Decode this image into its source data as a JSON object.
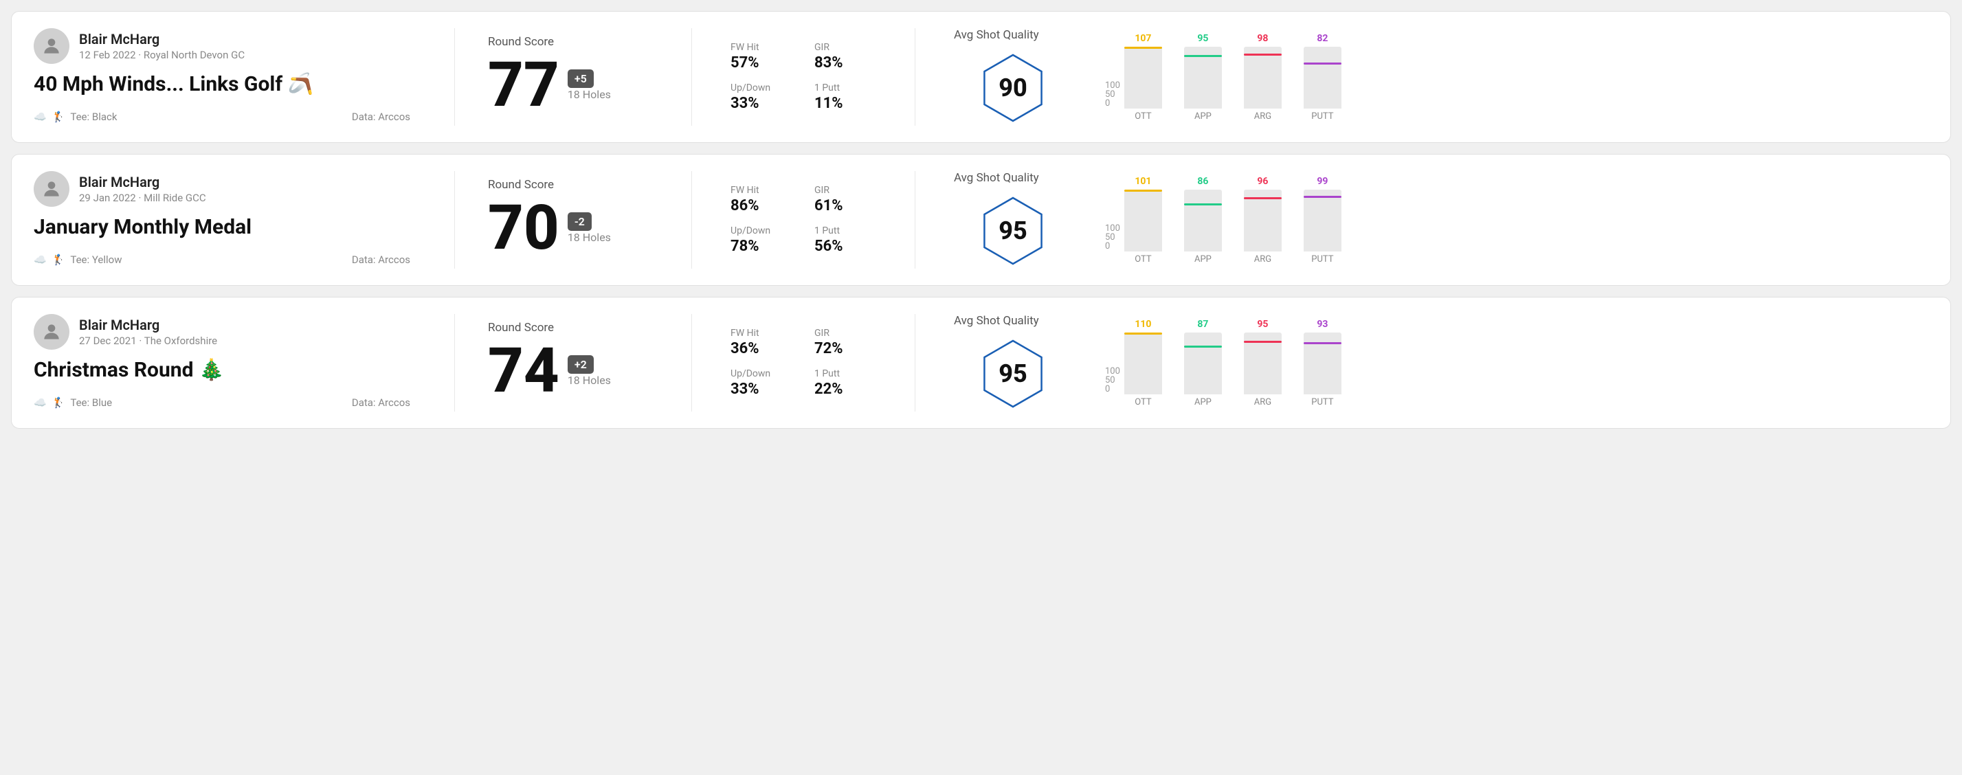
{
  "rounds": [
    {
      "id": "round-1",
      "user_name": "Blair McHarg",
      "date": "12 Feb 2022 · Royal North Devon GC",
      "title": "40 Mph Winds... Links Golf 🪃",
      "tee": "Black",
      "data_source": "Data: Arccos",
      "round_score_label": "Round Score",
      "score": "77",
      "score_diff": "+5",
      "holes": "18 Holes",
      "fw_hit_label": "FW Hit",
      "fw_hit_value": "57%",
      "gir_label": "GIR",
      "gir_value": "83%",
      "updown_label": "Up/Down",
      "updown_value": "33%",
      "oneputt_label": "1 Putt",
      "oneputt_value": "11%",
      "avg_shot_label": "Avg Shot Quality",
      "quality_score": "90",
      "chart_bars": [
        {
          "label": "OTT",
          "value": 107,
          "color": "#f0b800",
          "max": 100
        },
        {
          "label": "APP",
          "value": 95,
          "color": "#22cc88",
          "max": 100
        },
        {
          "label": "ARG",
          "value": 98,
          "color": "#ee3355",
          "max": 100
        },
        {
          "label": "PUTT",
          "value": 82,
          "color": "#aa44cc",
          "max": 100
        }
      ]
    },
    {
      "id": "round-2",
      "user_name": "Blair McHarg",
      "date": "29 Jan 2022 · Mill Ride GCC",
      "title": "January Monthly Medal",
      "tee": "Yellow",
      "data_source": "Data: Arccos",
      "round_score_label": "Round Score",
      "score": "70",
      "score_diff": "-2",
      "holes": "18 Holes",
      "fw_hit_label": "FW Hit",
      "fw_hit_value": "86%",
      "gir_label": "GIR",
      "gir_value": "61%",
      "updown_label": "Up/Down",
      "updown_value": "78%",
      "oneputt_label": "1 Putt",
      "oneputt_value": "56%",
      "avg_shot_label": "Avg Shot Quality",
      "quality_score": "95",
      "chart_bars": [
        {
          "label": "OTT",
          "value": 101,
          "color": "#f0b800",
          "max": 100
        },
        {
          "label": "APP",
          "value": 86,
          "color": "#22cc88",
          "max": 100
        },
        {
          "label": "ARG",
          "value": 96,
          "color": "#ee3355",
          "max": 100
        },
        {
          "label": "PUTT",
          "value": 99,
          "color": "#aa44cc",
          "max": 100
        }
      ]
    },
    {
      "id": "round-3",
      "user_name": "Blair McHarg",
      "date": "27 Dec 2021 · The Oxfordshire",
      "title": "Christmas Round 🎄",
      "tee": "Blue",
      "data_source": "Data: Arccos",
      "round_score_label": "Round Score",
      "score": "74",
      "score_diff": "+2",
      "holes": "18 Holes",
      "fw_hit_label": "FW Hit",
      "fw_hit_value": "36%",
      "gir_label": "GIR",
      "gir_value": "72%",
      "updown_label": "Up/Down",
      "updown_value": "33%",
      "oneputt_label": "1 Putt",
      "oneputt_value": "22%",
      "avg_shot_label": "Avg Shot Quality",
      "quality_score": "95",
      "chart_bars": [
        {
          "label": "OTT",
          "value": 110,
          "color": "#f0b800",
          "max": 100
        },
        {
          "label": "APP",
          "value": 87,
          "color": "#22cc88",
          "max": 100
        },
        {
          "label": "ARG",
          "value": 95,
          "color": "#ee3355",
          "max": 100
        },
        {
          "label": "PUTT",
          "value": 93,
          "color": "#aa44cc",
          "max": 100
        }
      ]
    }
  ],
  "axis_labels": [
    "100",
    "50",
    "0"
  ]
}
